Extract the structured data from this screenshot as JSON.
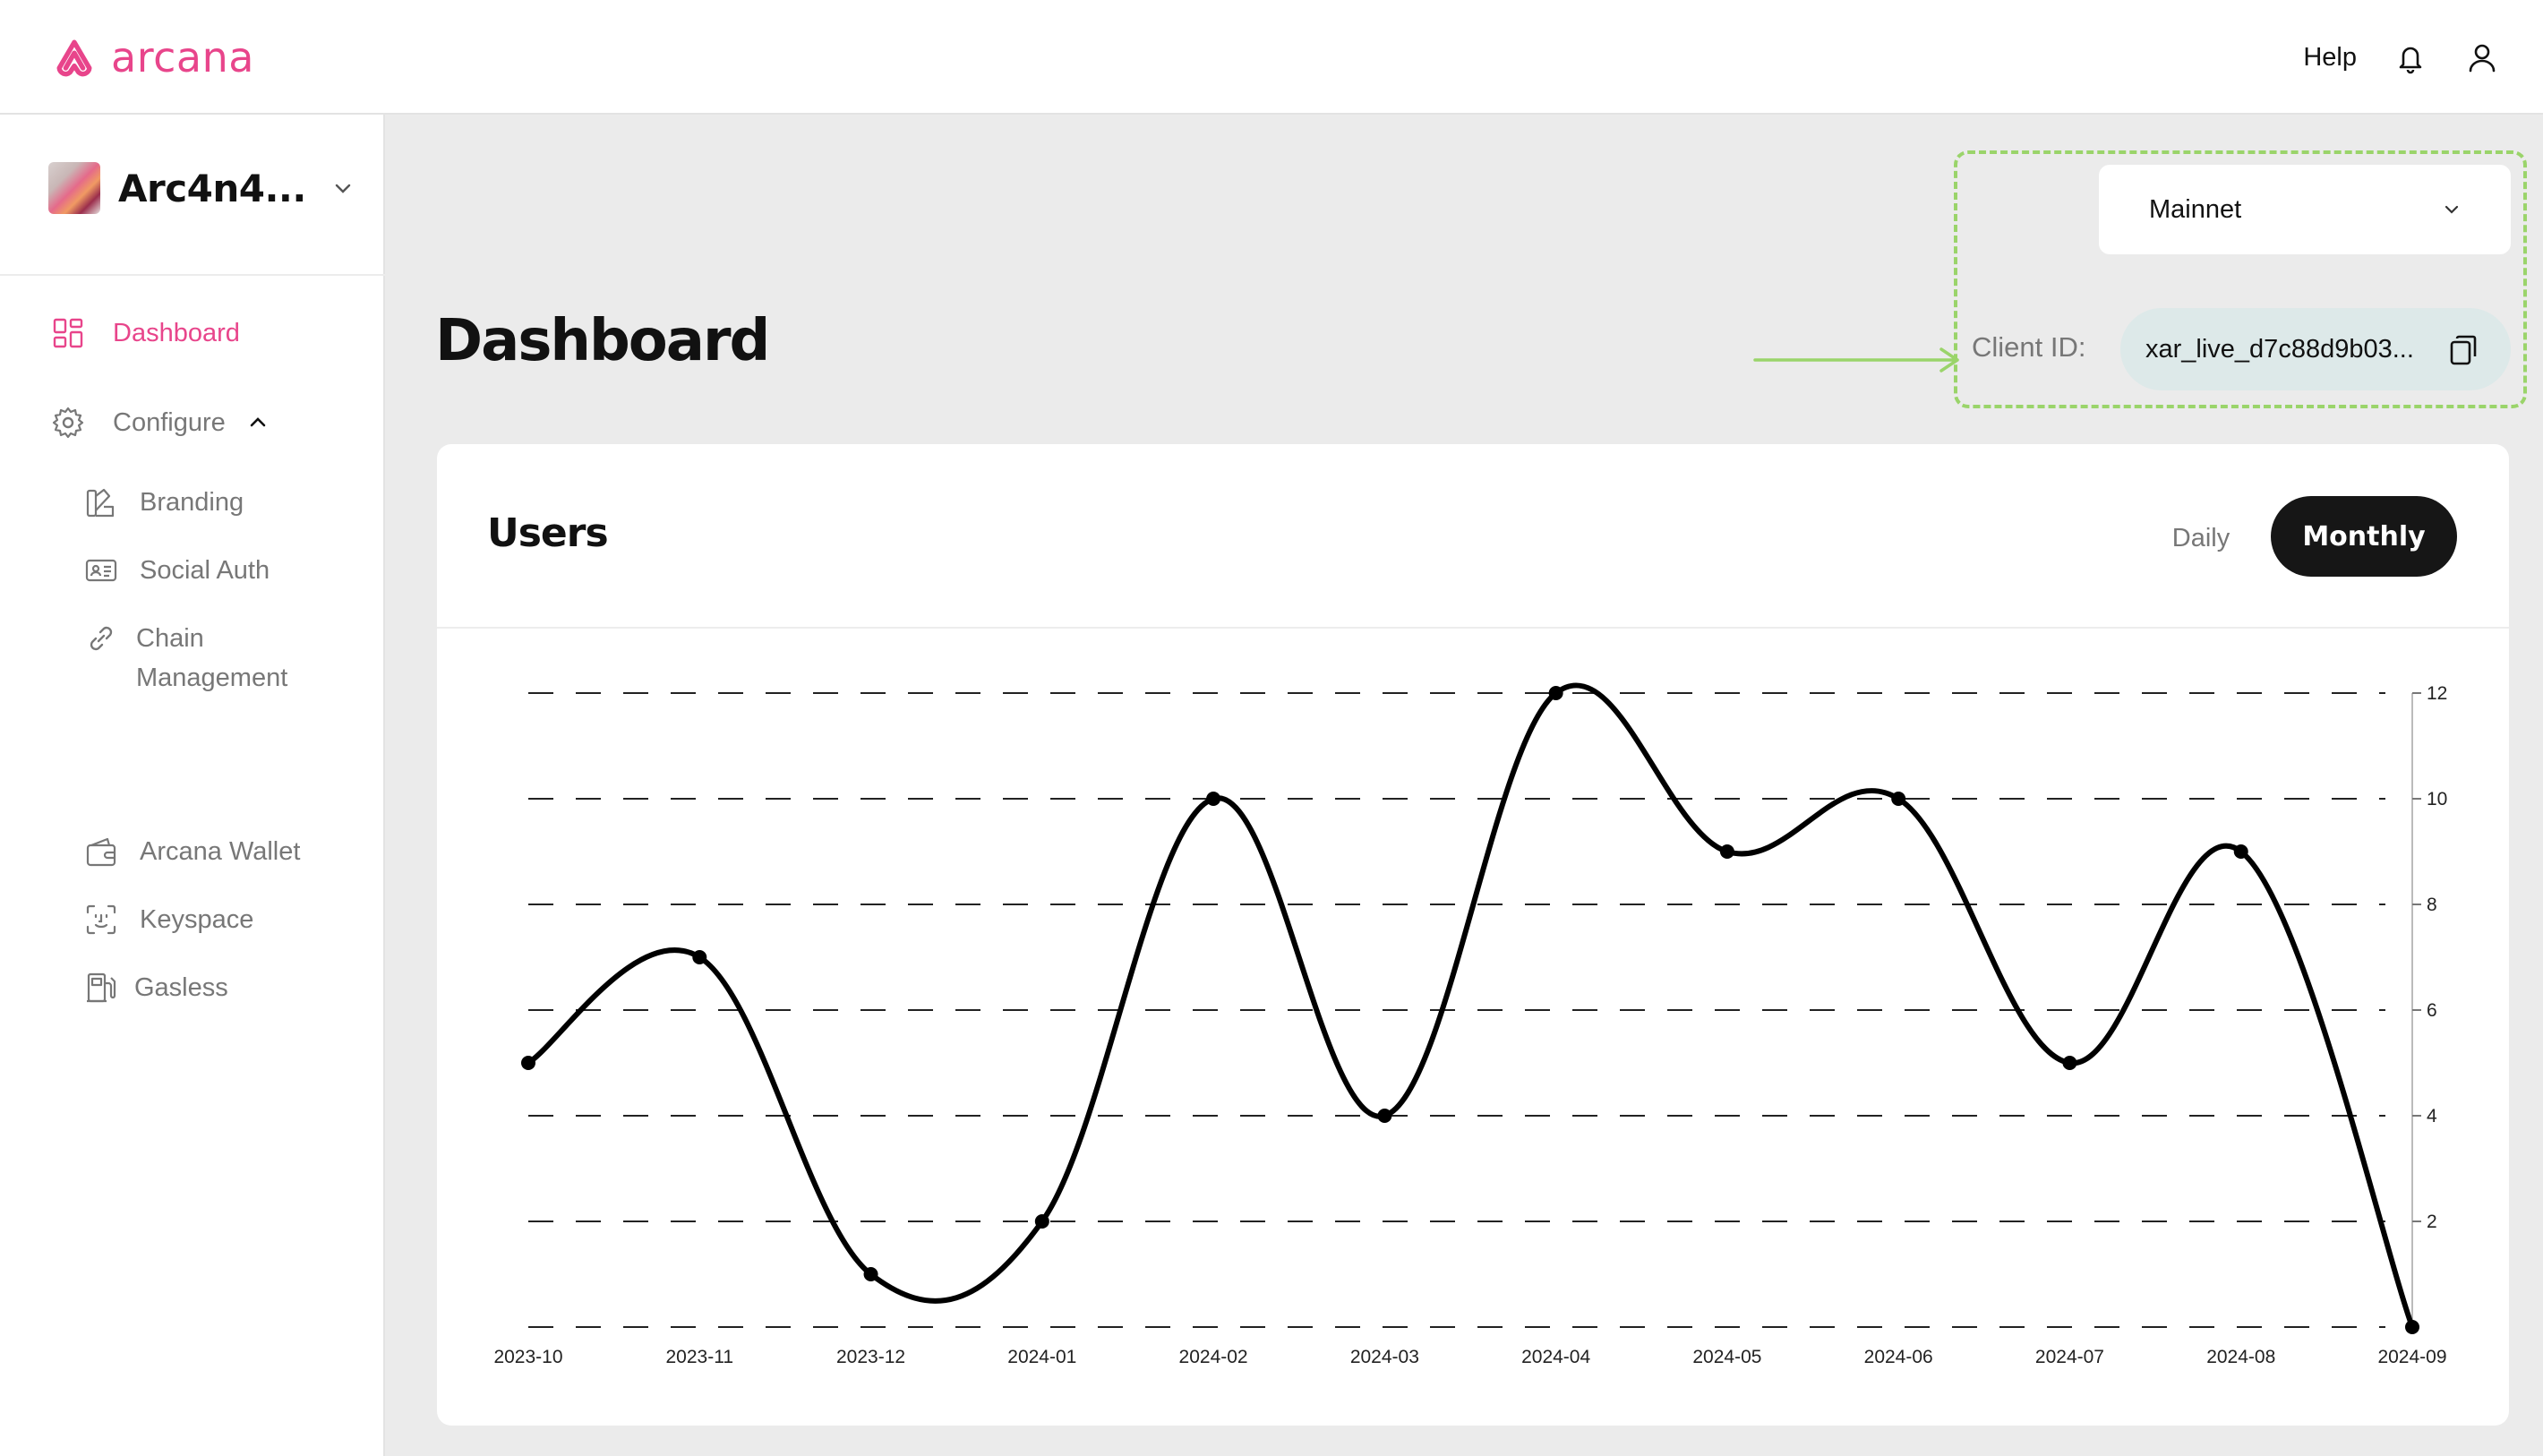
{
  "header": {
    "brand": "arcana",
    "help_label": "Help",
    "icons": {
      "logo": "arcana-logo-icon",
      "notifications": "bell-icon",
      "profile": "user-icon"
    },
    "brand_color": "#e8458b"
  },
  "sidebar": {
    "app_name": "Arc4n4...",
    "items": [
      {
        "label": "Dashboard",
        "icon": "grid-icon",
        "active": true
      },
      {
        "label": "Configure",
        "icon": "gear-icon",
        "expanded": true
      }
    ],
    "configure_items": [
      {
        "label": "Branding",
        "icon": "palette-icon"
      },
      {
        "label": "Social Auth",
        "icon": "id-card-icon"
      },
      {
        "label": "Chain",
        "label_line2": "Management",
        "icon": "link-icon"
      },
      {
        "label": "Arcana Wallet",
        "icon": "wallet-icon"
      },
      {
        "label": "Keyspace",
        "icon": "face-scan-icon"
      },
      {
        "label": "Gasless",
        "icon": "fuel-pump-icon"
      }
    ]
  },
  "main": {
    "title": "Dashboard",
    "network": {
      "selected": "Mainnet"
    },
    "client_id": {
      "label": "Client ID:",
      "value": "xar_live_d7c88d9b03..."
    },
    "highlight_color": "#9ad46a"
  },
  "users_card": {
    "title": "Users",
    "tabs": [
      {
        "label": "Daily",
        "active": false
      },
      {
        "label": "Monthly",
        "active": true
      }
    ]
  },
  "chart_data": {
    "type": "line",
    "x": [
      "2023-10",
      "2023-11",
      "2023-12",
      "2024-01",
      "2024-02",
      "2024-03",
      "2024-04",
      "2024-05",
      "2024-06",
      "2024-07",
      "2024-08",
      "2024-09"
    ],
    "values": [
      5,
      7,
      1,
      2,
      10,
      4,
      12,
      9,
      10,
      5,
      9,
      0
    ],
    "ylim": [
      0,
      12
    ],
    "yticks": [
      2,
      4,
      6,
      8,
      10,
      12
    ],
    "grid": true,
    "y_axis_side": "right",
    "line_color": "#000000"
  }
}
